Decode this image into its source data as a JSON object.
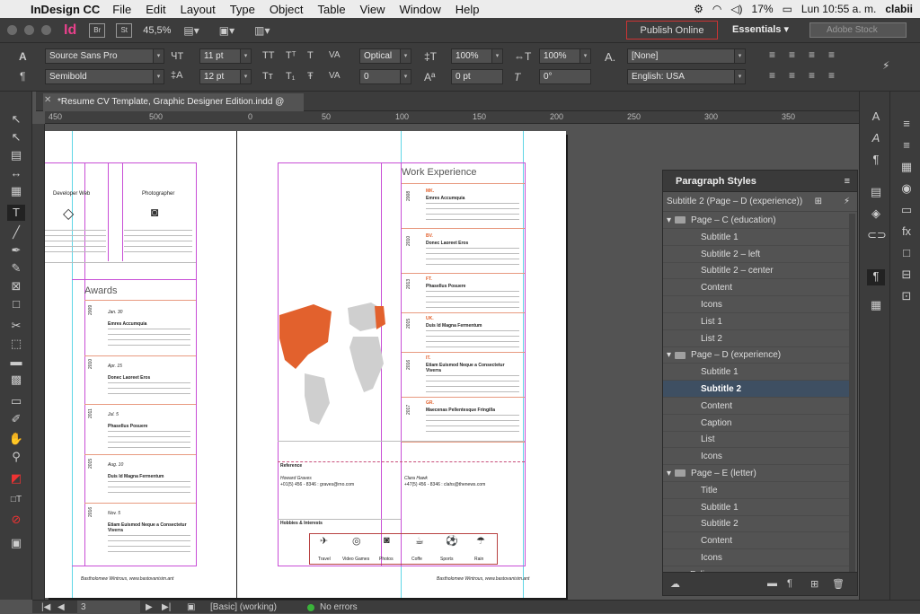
{
  "menubar": {
    "app_name": "InDesign CC",
    "menus": [
      "File",
      "Edit",
      "Layout",
      "Type",
      "Object",
      "Table",
      "View",
      "Window",
      "Help"
    ],
    "battery": "17%",
    "clock": "Lun 10:55 a. m.",
    "user": "clabii"
  },
  "appbar": {
    "logo": "Id",
    "bridge": "Br",
    "stock": "St",
    "zoom": "45,5%",
    "publish_label": "Publish Online",
    "workspace": "Essentials",
    "search_placeholder": "Adobe Stock"
  },
  "control": {
    "font_family": "Source Sans Pro",
    "font_style": "Semibold",
    "font_size": "11 pt",
    "leading": "12 pt",
    "kerning": "Optical",
    "tracking": "0",
    "vscale": "100%",
    "hscale": "100%",
    "baseline": "0 pt",
    "skew": "0°",
    "char_style": "[None]",
    "language": "English: USA"
  },
  "document": {
    "tab_title": "*Resume CV Template, Graphic Designer Edition.indd @ 45%"
  },
  "ruler": {
    "labels": [
      "450",
      "500",
      "0",
      "50",
      "100",
      "150",
      "200",
      "250",
      "300",
      "350"
    ]
  },
  "page_left": {
    "skill1": "Developer Web",
    "skill2": "Photographer",
    "awards_title": "Awards",
    "years": [
      "2009",
      "2010",
      "2011",
      "2015",
      "2016"
    ],
    "dates": [
      "Jan. 30",
      "Apr. 15",
      "Jul. 5",
      "Aug. 10",
      "Nov. 5"
    ],
    "award_titles": [
      "Emres Accumquia",
      "Donec Laoreet Eros",
      "Phasellus Posuere",
      "Duis Id Magna Fermentum",
      "Etiam Euismod Neque a Consectetur Viverra"
    ],
    "footer": "Bastholomew Wintrous, www.bastovanisim.ant"
  },
  "page_right": {
    "work_title": "Work Experience",
    "years": [
      "2008",
      "2010",
      "2013",
      "2015",
      "2016",
      "2017"
    ],
    "roles": [
      "MK.",
      "BV.",
      "FT.",
      "UK.",
      "IT.",
      "GR."
    ],
    "job_titles": [
      "Emres Accumquia",
      "Donec Laoreet Eros",
      "Phasellus Posuere",
      "Duis Id Magna Fermentum",
      "Etiam Euismod Neque a Consectetur Viverra",
      "Maecenas Pellentesque Fringilla"
    ],
    "reference_label": "Reference",
    "ref1_name": "Howard Graves",
    "ref1_contact": "+01(5) 456 - 8346 : graves@rno.com",
    "ref2_name": "Clara Hawk",
    "ref2_contact": "+47(5) 456 - 8346 : clahs@thenews.com",
    "hobbies_label": "Hobbies & Interests",
    "hobbies": [
      "Travel",
      "Video Games",
      "Photos",
      "Coffe",
      "Sports",
      "Rain"
    ],
    "footer": "Bastholomew Wintrous, www.bastovanisim.ant"
  },
  "paragraph_styles": {
    "title": "Paragraph Styles",
    "current": "Subtitle 2 (Page – D (experience))",
    "rows": [
      {
        "type": "group",
        "label": "Page – C (education)"
      },
      {
        "type": "item",
        "label": "Subtitle 1"
      },
      {
        "type": "item",
        "label": "Subtitle 2 – left"
      },
      {
        "type": "item",
        "label": "Subtitle 2 – center"
      },
      {
        "type": "item",
        "label": "Content"
      },
      {
        "type": "item",
        "label": "Icons"
      },
      {
        "type": "item",
        "label": "List 1"
      },
      {
        "type": "item",
        "label": "List 2"
      },
      {
        "type": "group",
        "label": "Page – D (experience)"
      },
      {
        "type": "item",
        "label": "Subtitle 1"
      },
      {
        "type": "item",
        "label": "Subtitle 2",
        "selected": true
      },
      {
        "type": "item",
        "label": "Content"
      },
      {
        "type": "item",
        "label": "Caption"
      },
      {
        "type": "item",
        "label": "List"
      },
      {
        "type": "item",
        "label": "Icons"
      },
      {
        "type": "group",
        "label": "Page – E (letter)"
      },
      {
        "type": "item",
        "label": "Title"
      },
      {
        "type": "item",
        "label": "Subtitle 1"
      },
      {
        "type": "item",
        "label": "Subtitle 2"
      },
      {
        "type": "item",
        "label": "Content"
      },
      {
        "type": "item",
        "label": "Icons"
      },
      {
        "type": "plain",
        "label": "Folio"
      }
    ]
  },
  "status": {
    "page": "3",
    "mode": "[Basic] (working)",
    "errors": "No errors"
  },
  "colors": {
    "accent": "#e2612d",
    "map_grey": "#cfcfcf",
    "selection": "#3e4f62"
  }
}
